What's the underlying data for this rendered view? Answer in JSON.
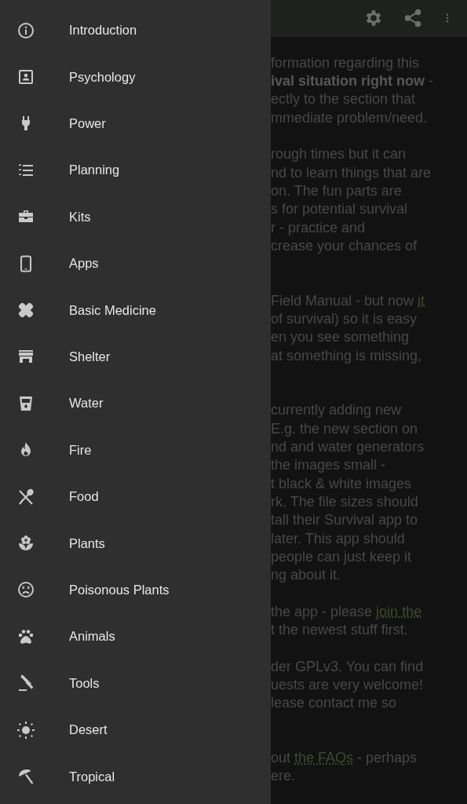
{
  "drawer": {
    "items": [
      {
        "label": "Introduction"
      },
      {
        "label": "Psychology"
      },
      {
        "label": "Power"
      },
      {
        "label": "Planning"
      },
      {
        "label": "Kits"
      },
      {
        "label": "Apps"
      },
      {
        "label": "Basic Medicine"
      },
      {
        "label": "Shelter"
      },
      {
        "label": "Water"
      },
      {
        "label": "Fire"
      },
      {
        "label": "Food"
      },
      {
        "label": "Plants"
      },
      {
        "label": "Poisonous Plants"
      },
      {
        "label": "Animals"
      },
      {
        "label": "Tools"
      },
      {
        "label": "Desert"
      },
      {
        "label": "Tropical"
      }
    ]
  },
  "content": {
    "paragraphs": [
      {
        "lines": [
          [
            {
              "kind": "text",
              "text": "formation regarding this"
            }
          ],
          [
            {
              "kind": "text",
              "text": "**ival situation right now** -"
            }
          ],
          [
            {
              "kind": "text",
              "text": "ectly to the section that"
            }
          ],
          [
            {
              "kind": "text",
              "text": "mmediate problem/need."
            }
          ]
        ]
      },
      {
        "lines": [
          [
            {
              "kind": "text",
              "text": "rough times but it can"
            }
          ],
          [
            {
              "kind": "text",
              "text": "nd to learn things that are"
            }
          ],
          [
            {
              "kind": "text",
              "text": "on. The fun parts are"
            }
          ],
          [
            {
              "kind": "text",
              "text": "s for potential survival"
            }
          ],
          [
            {
              "kind": "text",
              "text": "r - practice and"
            }
          ],
          [
            {
              "kind": "text",
              "text": "crease your chances of"
            }
          ]
        ]
      },
      {
        "lines": [
          [
            {
              "kind": "text",
              "text": "Field Manual - but now "
            },
            {
              "kind": "link",
              "text": "it"
            }
          ],
          [
            {
              "kind": "text",
              "text": "of survival) so it is easy"
            }
          ],
          [
            {
              "kind": "text",
              "text": "en you see something"
            }
          ],
          [
            {
              "kind": "text",
              "text": "at something is missing,"
            }
          ]
        ]
      },
      {
        "lines": [
          [
            {
              "kind": "text",
              "text": "currently adding new"
            }
          ],
          [
            {
              "kind": "text",
              "text": "E.g. the new section on"
            }
          ],
          [
            {
              "kind": "text",
              "text": "nd and water generators"
            }
          ],
          [
            {
              "kind": "text",
              "text": "the images small -"
            }
          ],
          [
            {
              "kind": "text",
              "text": "t black & white images"
            }
          ],
          [
            {
              "kind": "text",
              "text": "rk. The file sizes should"
            }
          ],
          [
            {
              "kind": "text",
              "text": "tall their Survival app to"
            }
          ],
          [
            {
              "kind": "text",
              "text": "later. This app should"
            }
          ],
          [
            {
              "kind": "text",
              "text": "people can just keep it"
            }
          ],
          [
            {
              "kind": "text",
              "text": "ng about it."
            }
          ]
        ]
      },
      {
        "lines": [
          [
            {
              "kind": "text",
              "text": "the app - please "
            },
            {
              "kind": "link",
              "text": "join the"
            }
          ],
          [
            {
              "kind": "text",
              "text": "t the newest stuff first."
            }
          ]
        ]
      },
      {
        "lines": [
          [
            {
              "kind": "text",
              "text": "der GPLv3. You can find"
            }
          ],
          [
            {
              "kind": "text",
              "text": "uests are very welcome!"
            }
          ],
          [
            {
              "kind": "text",
              "text": "lease contact me so"
            }
          ]
        ]
      },
      {
        "lines": [
          [
            {
              "kind": "text",
              "text": "out "
            },
            {
              "kind": "link",
              "text": "the FAQs"
            },
            {
              "kind": "text",
              "text": " - perhaps"
            }
          ],
          [
            {
              "kind": "text",
              "text": "ere."
            }
          ]
        ]
      }
    ]
  }
}
